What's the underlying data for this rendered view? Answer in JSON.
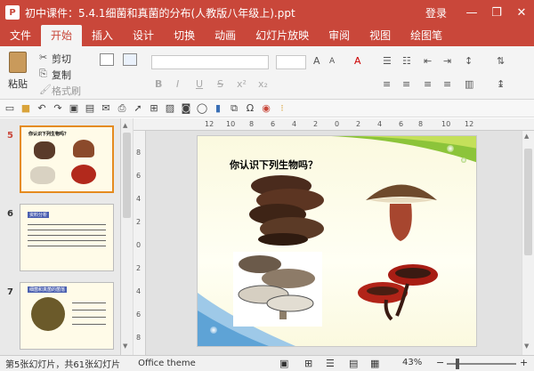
{
  "window": {
    "title": "初中课件：5.4.1细菌和真菌的分布(人教版八年级上).ppt",
    "login": "登录",
    "controls": [
      "—",
      "❐",
      "✕"
    ]
  },
  "ribbon_tabs": [
    "文件",
    "开始",
    "插入",
    "设计",
    "切换",
    "动画",
    "幻灯片放映",
    "审阅",
    "视图",
    "绘图笔"
  ],
  "clipboard": {
    "paste": "粘贴",
    "cut": "剪切",
    "copy": "复制",
    "format_painter": "格式刷"
  },
  "thumbnails": [
    {
      "num": "5",
      "title": "你认识下列生物吗？"
    },
    {
      "num": "6",
      "title": "资料分析"
    },
    {
      "num": "7",
      "title": "细菌和真菌的菌落"
    }
  ],
  "ruler": {
    "h_ticks": [
      "12",
      "10",
      "8",
      "6",
      "4",
      "2",
      "0",
      "2",
      "4",
      "6",
      "8",
      "10",
      "12"
    ],
    "v_ticks": [
      "8",
      "6",
      "4",
      "2",
      "0",
      "2",
      "4",
      "6",
      "8"
    ]
  },
  "slide": {
    "heading": "你认识下列生物吗？"
  },
  "status": {
    "slide_info": "第5张幻灯片，共61张幻灯片",
    "theme": "Office theme",
    "zoom": "43%"
  }
}
